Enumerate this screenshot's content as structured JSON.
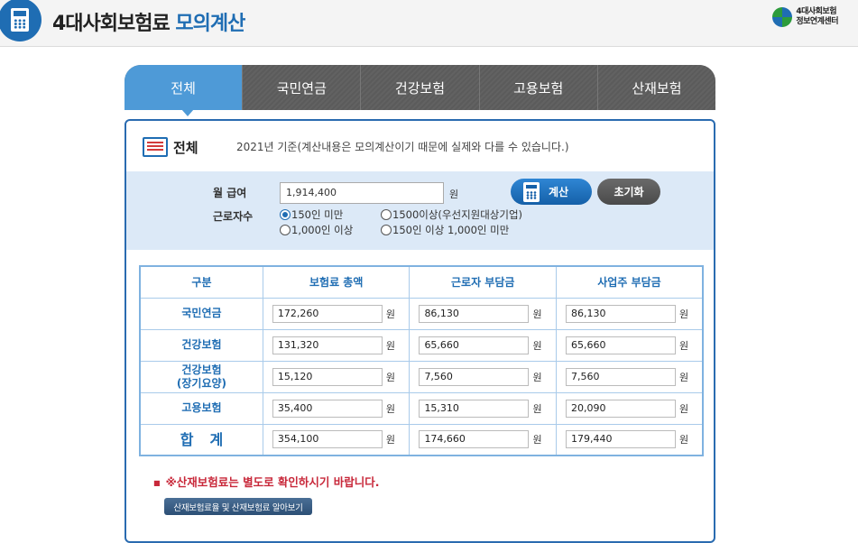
{
  "header": {
    "title_main": "4대사회보험료 ",
    "title_accent": "모의계산",
    "org_line1": "4대사회보험",
    "org_line2": "정보연계센터"
  },
  "tabs": [
    {
      "label": "전체",
      "active": true
    },
    {
      "label": "국민연금",
      "active": false
    },
    {
      "label": "건강보험",
      "active": false
    },
    {
      "label": "고용보험",
      "active": false
    },
    {
      "label": "산재보험",
      "active": false
    }
  ],
  "section": {
    "title": "전체",
    "note": "2021년 기준(계산내용은 모의계산이기 때문에 실제와 다를 수 있습니다.)"
  },
  "form": {
    "salary_label": "월 급여",
    "salary_value": "1,914,400",
    "won": "원",
    "workers_label": "근로자수",
    "calc_label": "계산",
    "reset_label": "초기화",
    "options": [
      {
        "label": "150인 미만",
        "checked": true
      },
      {
        "label": "1500이상(우선지원대상기업)",
        "checked": false
      },
      {
        "label": "1,000인 이상",
        "checked": false
      },
      {
        "label": "150인 이상 1,000인 미만",
        "checked": false
      }
    ]
  },
  "table": {
    "headers": [
      "구분",
      "보험료 총액",
      "근로자 부담금",
      "사업주 부담금"
    ],
    "rows": [
      {
        "name": "국민연금",
        "total": "172,260",
        "worker": "86,130",
        "employer": "86,130"
      },
      {
        "name": "건강보험",
        "total": "131,320",
        "worker": "65,660",
        "employer": "65,660"
      },
      {
        "name": "건강보험",
        "name2": "(장기요양)",
        "total": "15,120",
        "worker": "7,560",
        "employer": "7,560"
      },
      {
        "name": "고용보험",
        "total": "35,400",
        "worker": "15,310",
        "employer": "20,090"
      },
      {
        "name": "합계",
        "total": "354,100",
        "worker": "174,660",
        "employer": "179,440"
      }
    ]
  },
  "notice": "※산재보험료는 별도로 확인하시기 바랍니다.",
  "link_label": "산재보험료율 및 산재보험료 알아보기",
  "colors": {
    "accent": "#1f6db3",
    "tab_active": "#4e9ad7",
    "notice": "#c8283a"
  }
}
